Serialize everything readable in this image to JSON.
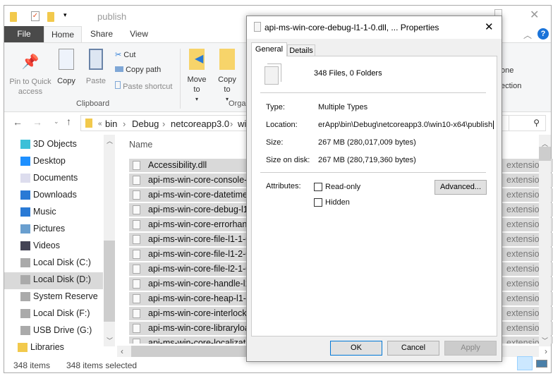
{
  "explorer": {
    "title": "publish",
    "ribbon_tabs": [
      "File",
      "Home",
      "Share",
      "View"
    ],
    "clipboard": {
      "pin": "Pin to Quick access",
      "copy": "Copy",
      "paste": "Paste",
      "cut": "Cut",
      "copy_path": "Copy path",
      "paste_shortcut": "Paste shortcut",
      "group": "Clipboard"
    },
    "organize": {
      "move_to": "Move to",
      "copy_to": "Copy to",
      "group": "Orga"
    },
    "select": {
      "none": "one",
      "invert": "ection"
    },
    "breadcrumb": [
      "«",
      "bin",
      "Debug",
      "netcoreapp3.0",
      "win"
    ],
    "nav_items": [
      "3D Objects",
      "Desktop",
      "Documents",
      "Downloads",
      "Music",
      "Pictures",
      "Videos",
      "Local Disk (C:)",
      "Local Disk (D:)",
      "System Reserve",
      "Local Disk (F:)",
      "USB Drive (G:)",
      "Libraries"
    ],
    "selected_nav": "Local Disk (D:)",
    "column_name": "Name",
    "files": [
      "Accessibility.dll",
      "api-ms-win-core-console-l1",
      "api-ms-win-core-datetime-",
      "api-ms-win-core-debug-l1-",
      "api-ms-win-core-errorhand",
      "api-ms-win-core-file-l1-1-0",
      "api-ms-win-core-file-l1-2-0",
      "api-ms-win-core-file-l2-1-0",
      "api-ms-win-core-handle-l1-",
      "api-ms-win-core-heap-l1-1",
      "api-ms-win-core-interlocke",
      "api-ms-win-core-libraryload",
      "api-ms-win-core-localization"
    ],
    "type_col": "extension",
    "status": {
      "items": "348 items",
      "selected": "348 items selected"
    }
  },
  "dialog": {
    "title": "api-ms-win-core-debug-l1-1-0.dll, ... Properties",
    "tabs": [
      "General",
      "Details"
    ],
    "summary": "348 Files, 0 Folders",
    "type_label": "Type:",
    "type_value": "Multiple Types",
    "location_label": "Location:",
    "location_value": "erApp\\bin\\Debug\\netcoreapp3.0\\win10-x64\\publish",
    "size_label": "Size:",
    "size_value": "267 MB (280,017,009 bytes)",
    "disk_label": "Size on disk:",
    "disk_value": "267 MB (280,719,360 bytes)",
    "attributes_label": "Attributes:",
    "readonly": "Read-only",
    "hidden": "Hidden",
    "readonly_checked": false,
    "hidden_checked": false,
    "advanced": "Advanced...",
    "ok": "OK",
    "cancel": "Cancel",
    "apply": "Apply"
  }
}
